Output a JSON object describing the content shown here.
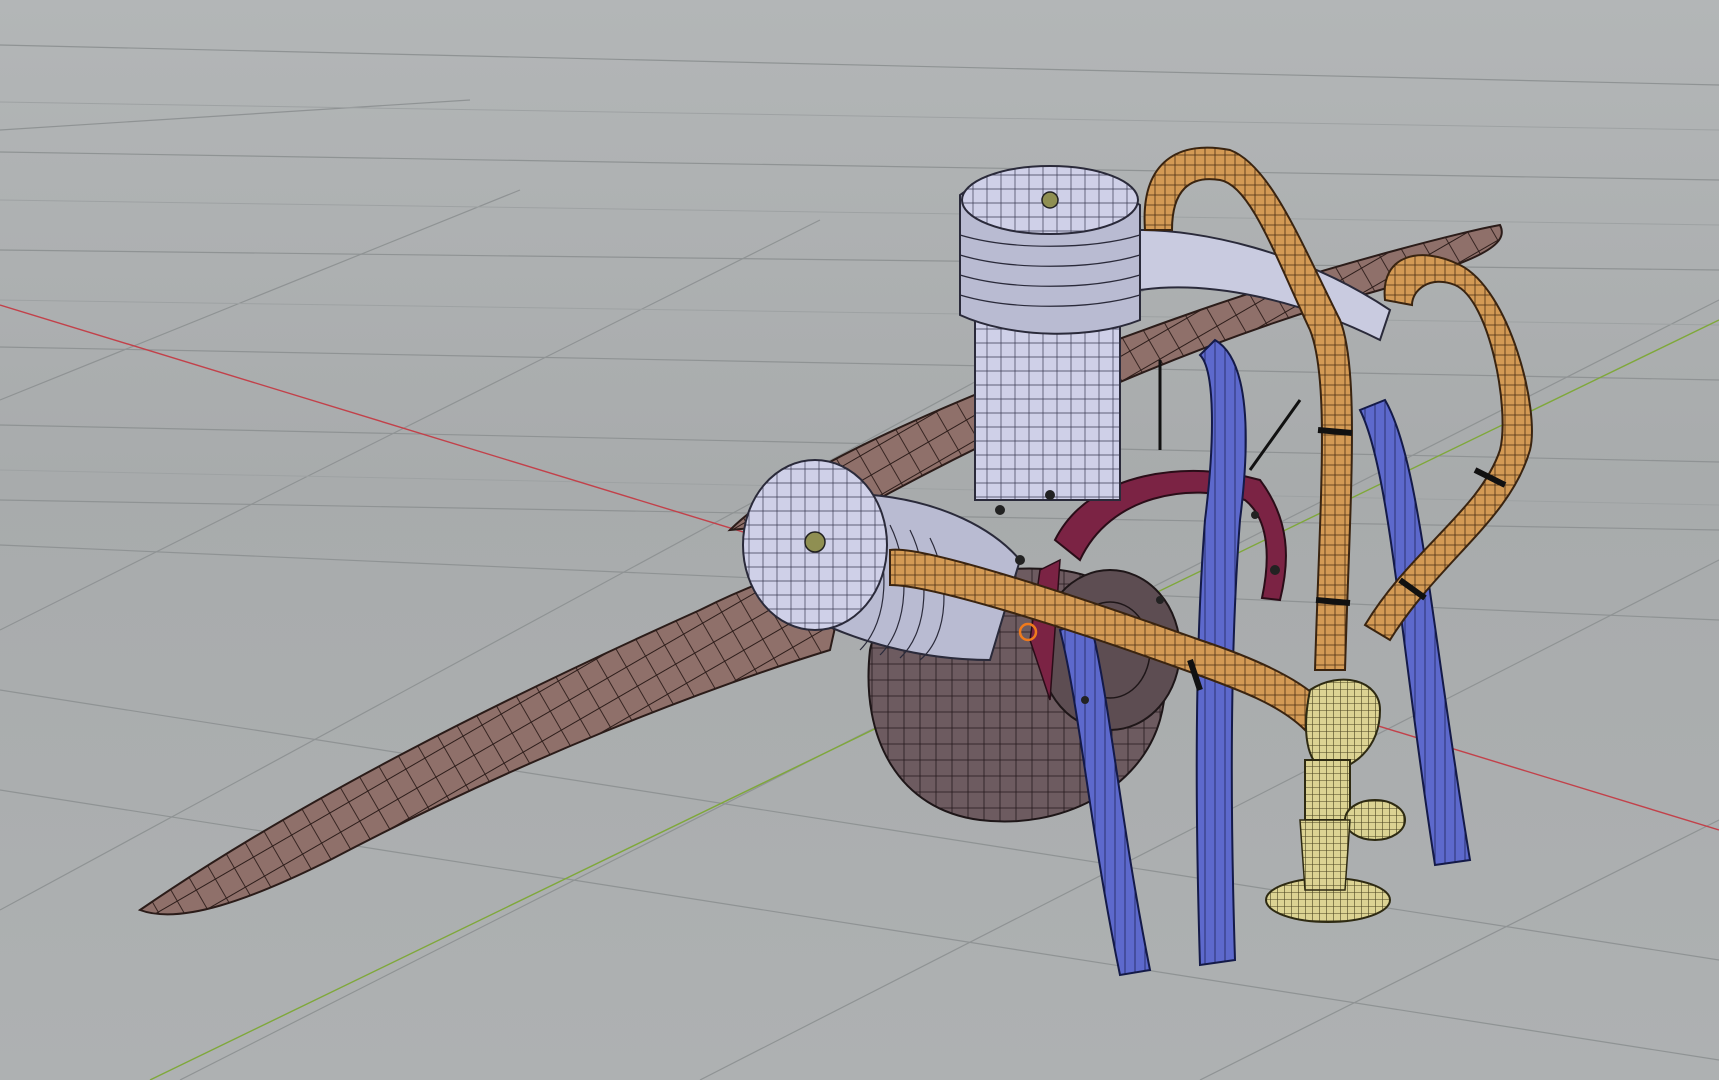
{
  "viewport": {
    "kind": "3d-viewport",
    "shading": "wireframe-over-solid",
    "background_color": "#abaeaf",
    "grid": true,
    "axis_colors": {
      "x_axis": "#c2414a",
      "y_axis": "#7fa83a"
    }
  },
  "model": {
    "parts": [
      {
        "name": "propeller",
        "color": "#8e6f6a"
      },
      {
        "name": "engine-cylinders",
        "color": "#cfd0e6"
      },
      {
        "name": "crankcase",
        "color": "#6c5a5e"
      },
      {
        "name": "exhaust-pipes",
        "color": "#d39a55"
      },
      {
        "name": "intake-pipes",
        "color": "#5a66c8"
      },
      {
        "name": "carburetor",
        "color": "#d8cf8e"
      },
      {
        "name": "magneto-bracket",
        "color": "#7a2242"
      }
    ]
  }
}
